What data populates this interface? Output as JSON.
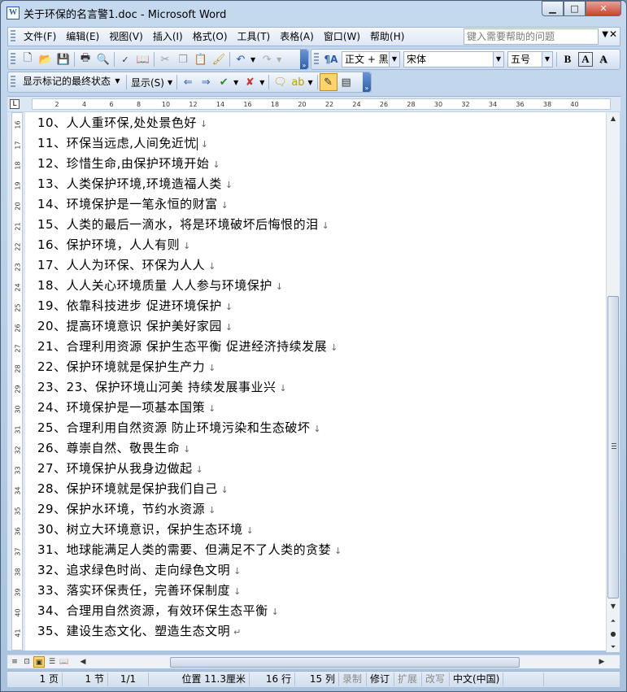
{
  "window": {
    "title": "关于环保的名言警1.doc - Microsoft Word",
    "min_label": "▁",
    "max_label": "□",
    "close_label": "✕"
  },
  "menu": {
    "items": [
      "文件(F)",
      "编辑(E)",
      "视图(V)",
      "插入(I)",
      "格式(O)",
      "工具(T)",
      "表格(A)",
      "窗口(W)",
      "帮助(H)"
    ],
    "help_placeholder": "键入需要帮助的问题",
    "close_label": "✕"
  },
  "format_toolbar": {
    "style_value": "正文 + 黑",
    "font_value": "宋体",
    "size_value": "五号",
    "bold_label": "B",
    "underline_label": "A",
    "shadow_label": "A"
  },
  "review_toolbar": {
    "markup_value": "显示标记的最终状态",
    "show_label": "显示(S)"
  },
  "ruler": {
    "corner_label": "L",
    "ticks": [
      "2",
      "4",
      "6",
      "8",
      "10",
      "12",
      "14",
      "16",
      "18",
      "20",
      "22",
      "24",
      "26",
      "28",
      "30",
      "32",
      "34",
      "36",
      "38",
      "40"
    ],
    "vticks": [
      "16",
      "17",
      "18",
      "19",
      "20",
      "21",
      "22",
      "23",
      "24",
      "25",
      "26",
      "27",
      "28",
      "29",
      "30",
      "31",
      "32",
      "33",
      "34",
      "35",
      "36",
      "37",
      "38",
      "39",
      "40",
      "41"
    ]
  },
  "document": {
    "lines": [
      "10、人人重环保,处处景色好",
      "11、环保当远虑,人间免近忧",
      "12、珍惜生命,由保护环境开始",
      "13、人类保护环境,环境造福人类",
      "14、环境保护是一笔永恒的财富",
      "15、人类的最后一滴水，将是环境破坏后悔恨的泪",
      "16、保护环境，人人有则",
      "17、人人为环保、环保为人人",
      "18、人人关心环境质量  人人参与环境保护",
      "19、依靠科技进步  促进环境保护",
      "20、提高环境意识  保护美好家园",
      "21、合理利用资源  保护生态平衡  促进经济持续发展",
      "22、保护环境就是保护生产力",
      "23、23、保护环境山河美  持续发展事业兴",
      "24、环境保护是一项基本国策",
      "25、合理利用自然资源  防止环境污染和生态破坏",
      "26、尊崇自然、敬畏生命",
      "27、环境保护从我身边做起",
      "28、保护环境就是保护我们自己",
      "29、保护水环境，节约水资源",
      "30、树立大环境意识，保护生态环境",
      "31、地球能满足人类的需要、但满足不了人类的贪婪",
      "32、追求绿色时尚、走向绿色文明",
      "33、落实环保责任，完善环保制度",
      "34、合理用自然资源，有效环保生态平衡",
      "35、建设生态文化、塑造生态文明"
    ]
  },
  "statusbar": {
    "page": "1 页",
    "section": "1 节",
    "page_of": "1/1",
    "position": "位置 11.3厘米",
    "line": "16 行",
    "column": "15 列",
    "rec": "录制",
    "trk": "修订",
    "ext": "扩展",
    "ovr": "改写",
    "language": "中文(中国)"
  }
}
